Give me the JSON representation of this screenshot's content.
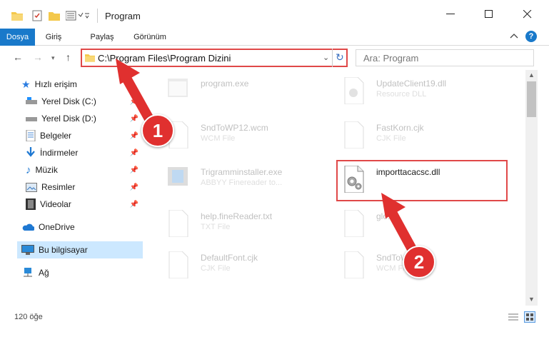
{
  "window": {
    "title": "Program"
  },
  "ribbon": {
    "tabs": [
      "Dosya",
      "Giriş",
      "Paylaş",
      "Görünüm"
    ]
  },
  "address": {
    "path": "C:\\Program Files\\Program Dizini",
    "search_placeholder": "Ara: Program"
  },
  "navigation": {
    "quick_access": "Hızlı erişim",
    "items": [
      {
        "label": "Yerel Disk (C:)",
        "icon": "drive-icon"
      },
      {
        "label": "Yerel Disk (D:)",
        "icon": "drive-icon"
      },
      {
        "label": "Belgeler",
        "icon": "documents-icon"
      },
      {
        "label": "İndirmeler",
        "icon": "download-icon"
      },
      {
        "label": "Müzik",
        "icon": "music-icon"
      },
      {
        "label": "Resimler",
        "icon": "pictures-icon"
      },
      {
        "label": "Videolar",
        "icon": "video-icon"
      }
    ],
    "onedrive": "OneDrive",
    "this_pc": "Bu bilgisayar",
    "network": "Ağ"
  },
  "files": [
    {
      "name": "program.exe",
      "type": ""
    },
    {
      "name": "UpdateClient19.dll",
      "type": "Resource DLL"
    },
    {
      "name": "SndToWP12.wcm",
      "type": "WCM File"
    },
    {
      "name": "FastKorn.cjk",
      "type": "CJK File"
    },
    {
      "name": "Trigramminstaller.exe",
      "type": "ABBYY Finereader to..."
    },
    {
      "name": "importtacacsc.dll",
      "type": ""
    },
    {
      "name": "help.fineReader.txt",
      "type": "TXT File"
    },
    {
      "name": "glo...",
      "type": ""
    },
    {
      "name": "DefaultFont.cjk",
      "type": "CJK File"
    },
    {
      "name": "SndToW...wcm",
      "type": "WCM File"
    }
  ],
  "status": {
    "count_text": "120 öğe"
  },
  "callouts": [
    "1",
    "2"
  ],
  "colors": {
    "accent": "#1979ca",
    "highlight": "#e04848",
    "callout": "#e0302f",
    "selected": "#cce8ff"
  }
}
